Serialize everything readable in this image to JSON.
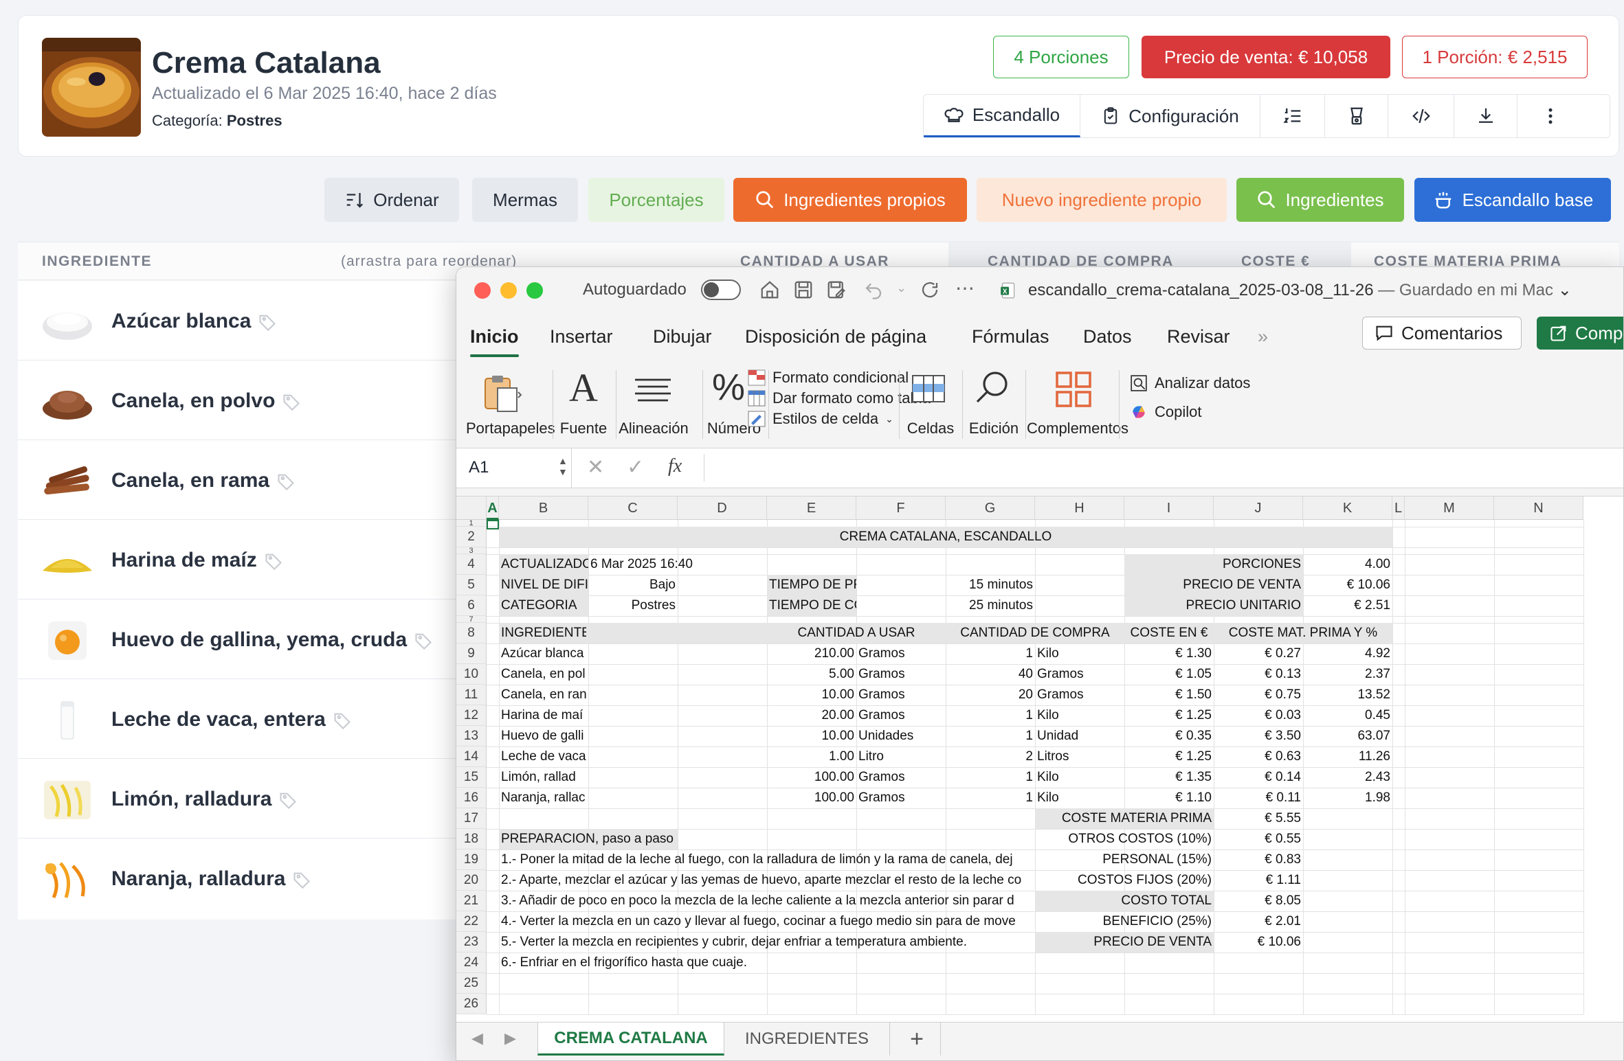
{
  "recipe": {
    "title": "Crema Catalana",
    "updated": "Actualizado el 6 Mar 2025 16:40, hace 2 días",
    "category_label": "Categoría: ",
    "category_value": "Postres"
  },
  "badges": {
    "portions": "4 Porciones",
    "sale_price": "Precio de venta: € 10,058",
    "unit_price": "1 Porción: € 2,515"
  },
  "tabs": {
    "escandallo": "Escandallo",
    "config": "Configuración"
  },
  "actions": {
    "order": "Ordenar",
    "mermas": "Mermas",
    "percent": "Porcentajes",
    "own": "Ingredientes propios",
    "new_own": "Nuevo ingrediente propio",
    "ingredients": "Ingredientes",
    "base": "Escandallo base"
  },
  "table_head": {
    "ingredient": "INGREDIENTE",
    "drag": "(arrastra para reordenar)",
    "qty_use": "CANTIDAD A USAR",
    "qty_buy": "CANTIDAD DE COMPRA",
    "cost": "COSTE €",
    "cost_raw": "COSTE MATERIA PRIMA"
  },
  "ingredients": [
    {
      "name": "Azúcar blanca",
      "icon": "sugar-icon"
    },
    {
      "name": "Canela, en polvo",
      "icon": "cinnamon-powder-icon"
    },
    {
      "name": "Canela, en rama",
      "icon": "cinnamon-stick-icon"
    },
    {
      "name": "Harina de maíz",
      "icon": "cornflour-icon"
    },
    {
      "name": "Huevo de gallina, yema, cruda",
      "icon": "egg-yolk-icon"
    },
    {
      "name": "Leche de vaca, entera",
      "icon": "milk-icon"
    },
    {
      "name": "Limón, ralladura",
      "icon": "lemon-zest-icon"
    },
    {
      "name": "Naranja, ralladura",
      "icon": "orange-zest-icon"
    }
  ],
  "excel": {
    "autosave": "Autoguardado",
    "filename": "escandallo_crema-catalana_2025-03-08_11-26",
    "saved": " — Guardado en mi Mac",
    "ribbon_tabs": [
      "Inicio",
      "Insertar",
      "Dibujar",
      "Disposición de página",
      "Fórmulas",
      "Datos",
      "Revisar"
    ],
    "comments": "Comentarios",
    "share": "Comp",
    "groups": {
      "clipboard": "Portapapeles",
      "font": "Fuente",
      "align": "Alineación",
      "number": "Número",
      "cells": "Celdas",
      "edit": "Edición",
      "addins": "Complementos",
      "analyze": "Analizar datos",
      "copilot": "Copilot"
    },
    "styles": [
      "Formato condicional",
      "Dar formato como tabla",
      "Estilos de celda"
    ],
    "namebox": "A1",
    "fx": "fx",
    "columns": [
      "A",
      "B",
      "C",
      "D",
      "E",
      "F",
      "G",
      "H",
      "I",
      "J",
      "K",
      "L",
      "M",
      "N"
    ],
    "rows": [
      "1",
      "2",
      "3",
      "4",
      "5",
      "6",
      "7",
      "8",
      "9",
      "10",
      "11",
      "12",
      "13",
      "14",
      "15",
      "16",
      "17",
      "18",
      "19",
      "20",
      "21",
      "22",
      "23",
      "24",
      "25",
      "26"
    ],
    "sheet_title": "CREMA CATALANA, ESCANDALLO",
    "meta": {
      "updated_l": "ACTUALIZADO",
      "updated_v": "6 Mar 2025 16:40",
      "diff_l": "NIVEL DE DIFI",
      "diff_v": "Bajo",
      "cat_l": "CATEGORIA",
      "cat_v": "Postres",
      "tprep_l": "TIEMPO DE PR",
      "tprep_v": "15 minutos",
      "tcook_l": "TIEMPO DE CC",
      "tcook_v": "25 minutos",
      "portions_l": "PORCIONES",
      "portions_v": "4.00",
      "price_l": "PRECIO DE VENTA",
      "price_v": "€ 10.06",
      "unit_l": "PRECIO UNITARIO",
      "unit_v": "€ 2.51"
    },
    "head": {
      "ing": "INGREDIENTE",
      "qty": "CANTIDAD A USAR",
      "buy": "CANTIDAD DE COMPRA",
      "cost": "COSTE EN €",
      "pct": "COSTE MAT. PRIMA Y %"
    },
    "rows_data": [
      {
        "name": "Azúcar blanca",
        "qty": "210.00",
        "unit": "Gramos",
        "bq": "1",
        "bu": "Kilo",
        "cost": "€ 1.30",
        "mp": "€ 0.27",
        "pct": "4.92"
      },
      {
        "name": "Canela, en pol",
        "qty": "5.00",
        "unit": "Gramos",
        "bq": "40",
        "bu": "Gramos",
        "cost": "€ 1.05",
        "mp": "€ 0.13",
        "pct": "2.37"
      },
      {
        "name": "Canela, en ran",
        "qty": "10.00",
        "unit": "Gramos",
        "bq": "20",
        "bu": "Gramos",
        "cost": "€ 1.50",
        "mp": "€ 0.75",
        "pct": "13.52"
      },
      {
        "name": "Harina de maí",
        "qty": "20.00",
        "unit": "Gramos",
        "bq": "1",
        "bu": "Kilo",
        "cost": "€ 1.25",
        "mp": "€ 0.03",
        "pct": "0.45"
      },
      {
        "name": "Huevo de galli",
        "qty": "10.00",
        "unit": "Unidades",
        "bq": "1",
        "bu": "Unidad",
        "cost": "€ 0.35",
        "mp": "€ 3.50",
        "pct": "63.07"
      },
      {
        "name": "Leche de vaca,",
        "qty": "1.00",
        "unit": "Litro",
        "bq": "2",
        "bu": "Litros",
        "cost": "€ 1.25",
        "mp": "€ 0.63",
        "pct": "11.26"
      },
      {
        "name": "Limón, rallad",
        "qty": "100.00",
        "unit": "Gramos",
        "bq": "1",
        "bu": "Kilo",
        "cost": "€ 1.35",
        "mp": "€ 0.14",
        "pct": "2.43"
      },
      {
        "name": "Naranja, rallac",
        "qty": "100.00",
        "unit": "Gramos",
        "bq": "1",
        "bu": "Kilo",
        "cost": "€ 1.10",
        "mp": "€ 0.11",
        "pct": "1.98"
      }
    ],
    "totals": [
      {
        "label": "COSTE MATERIA PRIMA",
        "value": "€ 5.55"
      },
      {
        "label": "OTROS COSTOS (10%)",
        "value": "€ 0.55"
      },
      {
        "label": "PERSONAL (15%)",
        "value": "€ 0.83"
      },
      {
        "label": "COSTOS FIJOS (20%)",
        "value": "€ 1.11"
      },
      {
        "label": "COSTO TOTAL",
        "value": "€ 8.05"
      },
      {
        "label": "BENEFICIO (25%)",
        "value": "€ 2.01"
      },
      {
        "label": "PRECIO DE VENTA",
        "value": "€ 10.06"
      }
    ],
    "prep_title": "PREPARACION, paso a paso",
    "steps": [
      "1.- Poner la mitad de la leche al fuego, con la ralladura de limón y la rama de canela, dej",
      "2.- Aparte, mezclar el azúcar y las yemas de huevo, aparte mezclar el resto de la leche co",
      "3.- Añadir de poco en poco la mezcla de la leche caliente a la mezcla anterior sin parar d",
      "4.- Verter la mezcla en un cazo y llevar al fuego, cocinar a fuego medio sin para de move",
      "5.- Verter la mezcla en recipientes y cubrir, dejar enfriar a temperatura ambiente.",
      "6.- Enfriar en el frigorífico hasta que cuaje."
    ],
    "sheets": [
      "CREMA CATALANA",
      "INGREDIENTES"
    ],
    "add_sheet": "+"
  }
}
